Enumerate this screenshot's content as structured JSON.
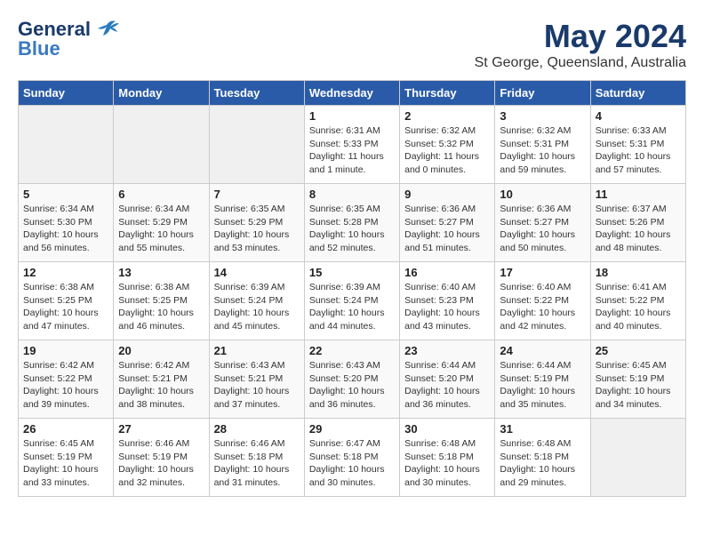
{
  "header": {
    "logo_general": "General",
    "logo_blue": "Blue",
    "month": "May 2024",
    "location": "St George, Queensland, Australia"
  },
  "weekdays": [
    "Sunday",
    "Monday",
    "Tuesday",
    "Wednesday",
    "Thursday",
    "Friday",
    "Saturday"
  ],
  "weeks": [
    [
      {
        "day": "",
        "empty": true
      },
      {
        "day": "",
        "empty": true
      },
      {
        "day": "",
        "empty": true
      },
      {
        "day": "1",
        "sunrise": "6:31 AM",
        "sunset": "5:33 PM",
        "daylight": "11 hours and 1 minute."
      },
      {
        "day": "2",
        "sunrise": "6:32 AM",
        "sunset": "5:32 PM",
        "daylight": "11 hours and 0 minutes."
      },
      {
        "day": "3",
        "sunrise": "6:32 AM",
        "sunset": "5:31 PM",
        "daylight": "10 hours and 59 minutes."
      },
      {
        "day": "4",
        "sunrise": "6:33 AM",
        "sunset": "5:31 PM",
        "daylight": "10 hours and 57 minutes."
      }
    ],
    [
      {
        "day": "5",
        "sunrise": "6:34 AM",
        "sunset": "5:30 PM",
        "daylight": "10 hours and 56 minutes."
      },
      {
        "day": "6",
        "sunrise": "6:34 AM",
        "sunset": "5:29 PM",
        "daylight": "10 hours and 55 minutes."
      },
      {
        "day": "7",
        "sunrise": "6:35 AM",
        "sunset": "5:29 PM",
        "daylight": "10 hours and 53 minutes."
      },
      {
        "day": "8",
        "sunrise": "6:35 AM",
        "sunset": "5:28 PM",
        "daylight": "10 hours and 52 minutes."
      },
      {
        "day": "9",
        "sunrise": "6:36 AM",
        "sunset": "5:27 PM",
        "daylight": "10 hours and 51 minutes."
      },
      {
        "day": "10",
        "sunrise": "6:36 AM",
        "sunset": "5:27 PM",
        "daylight": "10 hours and 50 minutes."
      },
      {
        "day": "11",
        "sunrise": "6:37 AM",
        "sunset": "5:26 PM",
        "daylight": "10 hours and 48 minutes."
      }
    ],
    [
      {
        "day": "12",
        "sunrise": "6:38 AM",
        "sunset": "5:25 PM",
        "daylight": "10 hours and 47 minutes."
      },
      {
        "day": "13",
        "sunrise": "6:38 AM",
        "sunset": "5:25 PM",
        "daylight": "10 hours and 46 minutes."
      },
      {
        "day": "14",
        "sunrise": "6:39 AM",
        "sunset": "5:24 PM",
        "daylight": "10 hours and 45 minutes."
      },
      {
        "day": "15",
        "sunrise": "6:39 AM",
        "sunset": "5:24 PM",
        "daylight": "10 hours and 44 minutes."
      },
      {
        "day": "16",
        "sunrise": "6:40 AM",
        "sunset": "5:23 PM",
        "daylight": "10 hours and 43 minutes."
      },
      {
        "day": "17",
        "sunrise": "6:40 AM",
        "sunset": "5:22 PM",
        "daylight": "10 hours and 42 minutes."
      },
      {
        "day": "18",
        "sunrise": "6:41 AM",
        "sunset": "5:22 PM",
        "daylight": "10 hours and 40 minutes."
      }
    ],
    [
      {
        "day": "19",
        "sunrise": "6:42 AM",
        "sunset": "5:22 PM",
        "daylight": "10 hours and 39 minutes."
      },
      {
        "day": "20",
        "sunrise": "6:42 AM",
        "sunset": "5:21 PM",
        "daylight": "10 hours and 38 minutes."
      },
      {
        "day": "21",
        "sunrise": "6:43 AM",
        "sunset": "5:21 PM",
        "daylight": "10 hours and 37 minutes."
      },
      {
        "day": "22",
        "sunrise": "6:43 AM",
        "sunset": "5:20 PM",
        "daylight": "10 hours and 36 minutes."
      },
      {
        "day": "23",
        "sunrise": "6:44 AM",
        "sunset": "5:20 PM",
        "daylight": "10 hours and 36 minutes."
      },
      {
        "day": "24",
        "sunrise": "6:44 AM",
        "sunset": "5:19 PM",
        "daylight": "10 hours and 35 minutes."
      },
      {
        "day": "25",
        "sunrise": "6:45 AM",
        "sunset": "5:19 PM",
        "daylight": "10 hours and 34 minutes."
      }
    ],
    [
      {
        "day": "26",
        "sunrise": "6:45 AM",
        "sunset": "5:19 PM",
        "daylight": "10 hours and 33 minutes."
      },
      {
        "day": "27",
        "sunrise": "6:46 AM",
        "sunset": "5:19 PM",
        "daylight": "10 hours and 32 minutes."
      },
      {
        "day": "28",
        "sunrise": "6:46 AM",
        "sunset": "5:18 PM",
        "daylight": "10 hours and 31 minutes."
      },
      {
        "day": "29",
        "sunrise": "6:47 AM",
        "sunset": "5:18 PM",
        "daylight": "10 hours and 30 minutes."
      },
      {
        "day": "30",
        "sunrise": "6:48 AM",
        "sunset": "5:18 PM",
        "daylight": "10 hours and 30 minutes."
      },
      {
        "day": "31",
        "sunrise": "6:48 AM",
        "sunset": "5:18 PM",
        "daylight": "10 hours and 29 minutes."
      },
      {
        "day": "",
        "empty": true
      }
    ]
  ]
}
